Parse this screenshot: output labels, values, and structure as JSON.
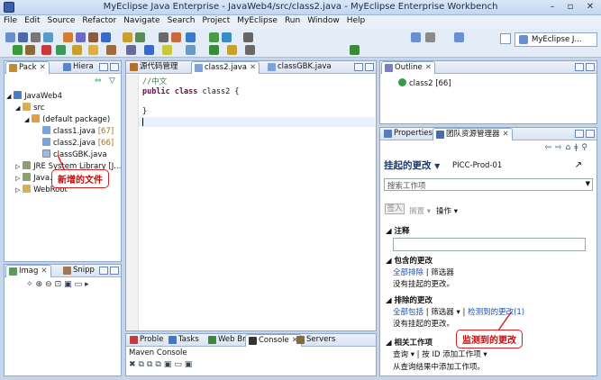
{
  "window": {
    "title": "MyEclipse Java Enterprise - JavaWeb4/src/class2.java - MyEclipse Enterprise Workbench"
  },
  "menu": [
    "File",
    "Edit",
    "Source",
    "Refactor",
    "Navigate",
    "Search",
    "Project",
    "MyEclipse",
    "Run",
    "Window",
    "Help"
  ],
  "toolbar": {
    "perspective_label": "MyEclipse J..."
  },
  "left_panel": {
    "tabs": [
      {
        "label": "Pack"
      },
      {
        "label": "Hiera"
      }
    ],
    "tree": {
      "project": "JavaWeb4",
      "src": "src",
      "package": "(default package)",
      "files": [
        {
          "name": "class1.java",
          "rev": "[67]"
        },
        {
          "name": "class2.java",
          "rev": "[66]"
        },
        {
          "name": "classGBK.java",
          "rev": ""
        }
      ],
      "jre": "JRE System Library [J...",
      "javaee": "Java...",
      "webroot": "WebRoot"
    }
  },
  "image_panel": {
    "tabs": [
      {
        "label": "Imag"
      },
      {
        "label": "Snipp"
      }
    ]
  },
  "editor": {
    "tabs": [
      {
        "label": "源代码管理"
      },
      {
        "label": "class2.java"
      },
      {
        "label": "classGBK.java"
      }
    ],
    "lines": [
      "//中文",
      "public class class2 {",
      "",
      "}"
    ]
  },
  "outline": {
    "tab": "Outline",
    "item": "class2 [66]"
  },
  "team_panel": {
    "tabs": [
      {
        "label": "Properties"
      },
      {
        "label": "团队资源管理器"
      }
    ],
    "heading": "挂起的更改",
    "project": "PICC-Prod-01",
    "search_placeholder": "搜索工作项",
    "checkin": "签入",
    "shelve": "搁置",
    "actions": "操作",
    "notes_title": "注释",
    "included_title": "包含的更改",
    "exclude_all": "全部排除",
    "filter": "筛选器",
    "no_pending": "没有挂起的更改。",
    "excluded_title": "排除的更改",
    "include_all": "全部包括",
    "detected": "检测到的更改(1)",
    "related_title": "相关工作项",
    "query": "查询",
    "add_by_id": "按 ID 添加工作项",
    "add_from_query": "从查询结果中添加工作项。"
  },
  "bottom_panel": {
    "tabs": [
      {
        "label": "Proble"
      },
      {
        "label": "Tasks"
      },
      {
        "label": "Web Br"
      },
      {
        "label": "Console"
      },
      {
        "label": "Servers"
      }
    ],
    "console_title": "Maven Console"
  },
  "annotations": {
    "new_file": "新增的文件",
    "detected_changes": "监测到的更改"
  }
}
